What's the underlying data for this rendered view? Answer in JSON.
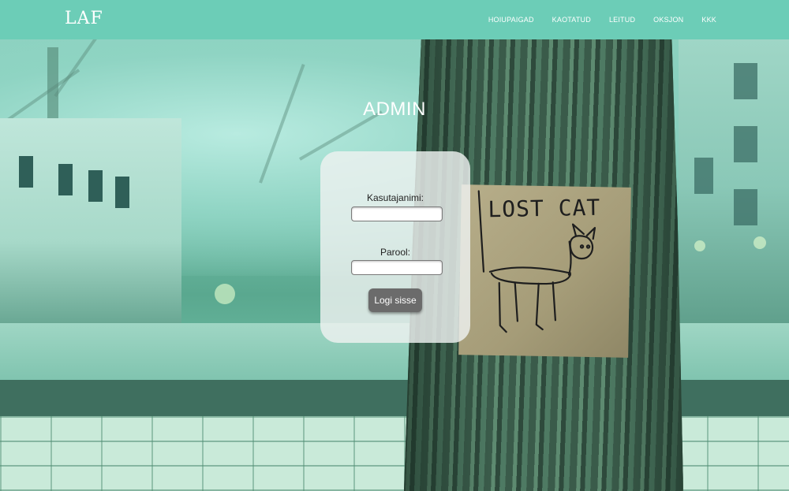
{
  "header": {
    "logo": "LAF",
    "nav": [
      "HOIUPAIGAD",
      "KAOTATUD",
      "LEITUD",
      "OKSJON",
      "KKK"
    ]
  },
  "page": {
    "title": "ADMIN"
  },
  "login": {
    "username_label": "Kasutajanimi:",
    "username_value": "",
    "password_label": "Parool:",
    "password_value": "",
    "submit_label": "Logi sisse"
  },
  "background": {
    "sign_text": "LOST CAT"
  },
  "colors": {
    "header": "#6ccdb7",
    "button": "#6b6b6b"
  }
}
